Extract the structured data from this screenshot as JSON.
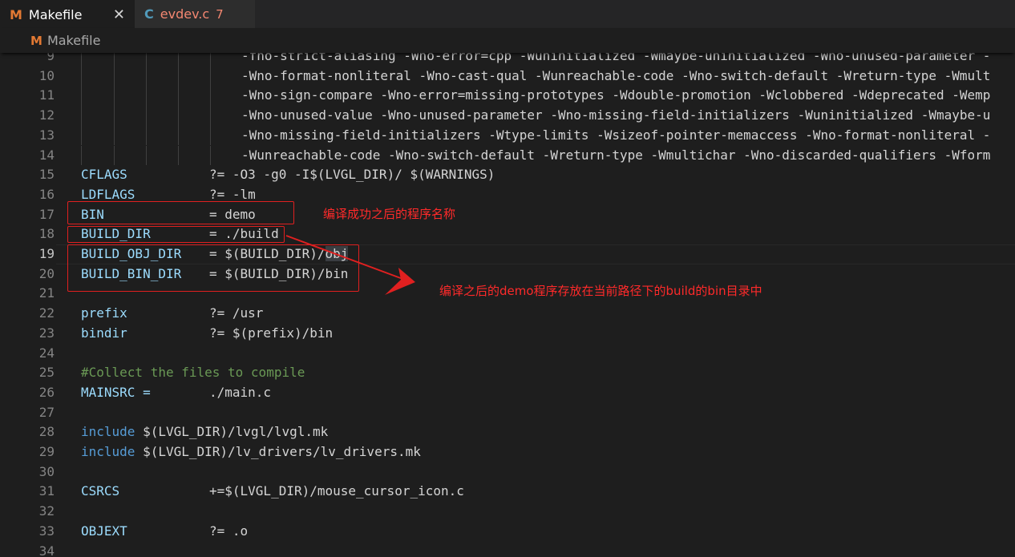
{
  "tabs": [
    {
      "icon": "M",
      "label": "Makefile",
      "close": "✕",
      "active": true
    },
    {
      "icon": "C",
      "label": "evdev.c",
      "badge": "7",
      "active": false
    }
  ],
  "breadcrumb": {
    "icon": "M",
    "label": "Makefile"
  },
  "current_line": "19",
  "lines": [
    {
      "n": "9",
      "text": "-fno-strict-aliasing -Wno-error=cpp -Wuninitialized -Wmaybe-uninitialized -Wno-unused-parameter -"
    },
    {
      "n": "10",
      "text": "-Wno-format-nonliteral -Wno-cast-qual -Wunreachable-code -Wno-switch-default -Wreturn-type -Wmult"
    },
    {
      "n": "11",
      "text": "-Wno-sign-compare -Wno-error=missing-prototypes -Wdouble-promotion -Wclobbered -Wdeprecated -Wemp"
    },
    {
      "n": "12",
      "text": "-Wno-unused-value -Wno-unused-parameter -Wno-missing-field-initializers -Wuninitialized -Wmaybe-u"
    },
    {
      "n": "13",
      "text": "-Wno-missing-field-initializers -Wtype-limits -Wsizeof-pointer-memaccess -Wno-format-nonliteral -"
    },
    {
      "n": "14",
      "text": "-Wunreachable-code -Wno-switch-default -Wreturn-type -Wmultichar -Wno-discarded-qualifiers -Wform"
    },
    {
      "n": "15",
      "var": "CFLAGS",
      "op": "?= -O3 -g0 -I",
      "rest": "$(LVGL_DIR)/ $(WARNINGS)"
    },
    {
      "n": "16",
      "var": "LDFLAGS",
      "op": "?= -lm"
    },
    {
      "n": "17",
      "var": "BIN",
      "op": "= demo"
    },
    {
      "n": "18",
      "var": "BUILD_DIR",
      "op": "= ./build"
    },
    {
      "n": "19",
      "var": "BUILD_OBJ_DIR",
      "op": "= $(BUILD_DIR)/",
      "sel": "obj"
    },
    {
      "n": "20",
      "var": "BUILD_BIN_DIR",
      "op": "= $(BUILD_DIR)/bin"
    },
    {
      "n": "21"
    },
    {
      "n": "22",
      "var": "prefix",
      "op": "?= /usr"
    },
    {
      "n": "23",
      "var": "bindir",
      "op": "?= $(prefix)/bin"
    },
    {
      "n": "24"
    },
    {
      "n": "25",
      "comment": "#Collect the files to compile"
    },
    {
      "n": "26",
      "var": "MAINSRC =",
      "op": "./main.c"
    },
    {
      "n": "27"
    },
    {
      "n": "28",
      "kw": "include",
      "rest": "$(LVGL_DIR)/lvgl/lvgl.mk"
    },
    {
      "n": "29",
      "kw": "include",
      "rest": "$(LVGL_DIR)/lv_drivers/lv_drivers.mk"
    },
    {
      "n": "30"
    },
    {
      "n": "31",
      "var": "CSRCS",
      "op": "+=$(LVGL_DIR)/mouse_cursor_icon.c"
    },
    {
      "n": "32"
    },
    {
      "n": "33",
      "var": "OBJEXT",
      "op": "?= .o"
    },
    {
      "n": "34"
    }
  ],
  "annotations": {
    "bin_note": "编译成功之后的程序名称",
    "build_note": "编译之后的demo程序存放在当前路径下的build的bin目录中",
    "color": "#e02020"
  }
}
